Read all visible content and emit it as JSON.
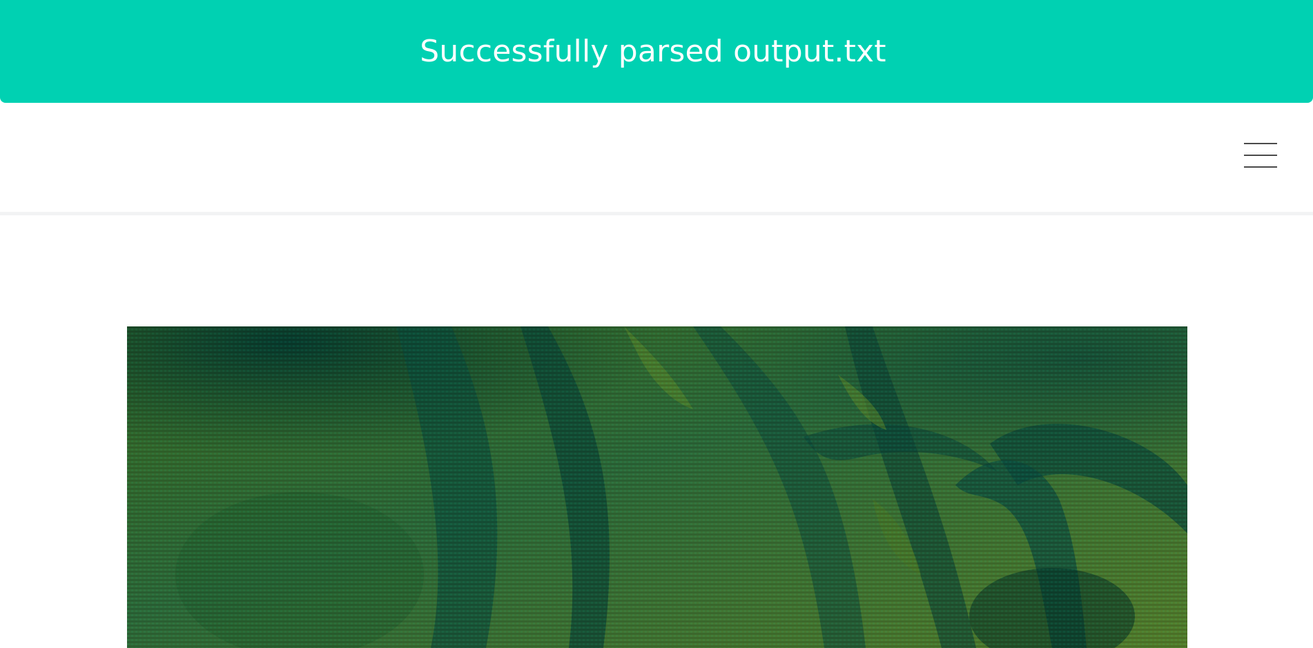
{
  "notification": {
    "message": "Successfully parsed output.txt",
    "background_color": "#00d1b2",
    "text_color": "#ffffff"
  },
  "navbar": {
    "menu_icon": "hamburger-icon",
    "icon_color": "#4a4a4a"
  },
  "main": {
    "image": {
      "description_icon": "image-preview",
      "palette": [
        "#2f6b2c",
        "#0d4a3a",
        "#1b5e4a",
        "#4c7a26",
        "#5f8a2a"
      ]
    }
  }
}
